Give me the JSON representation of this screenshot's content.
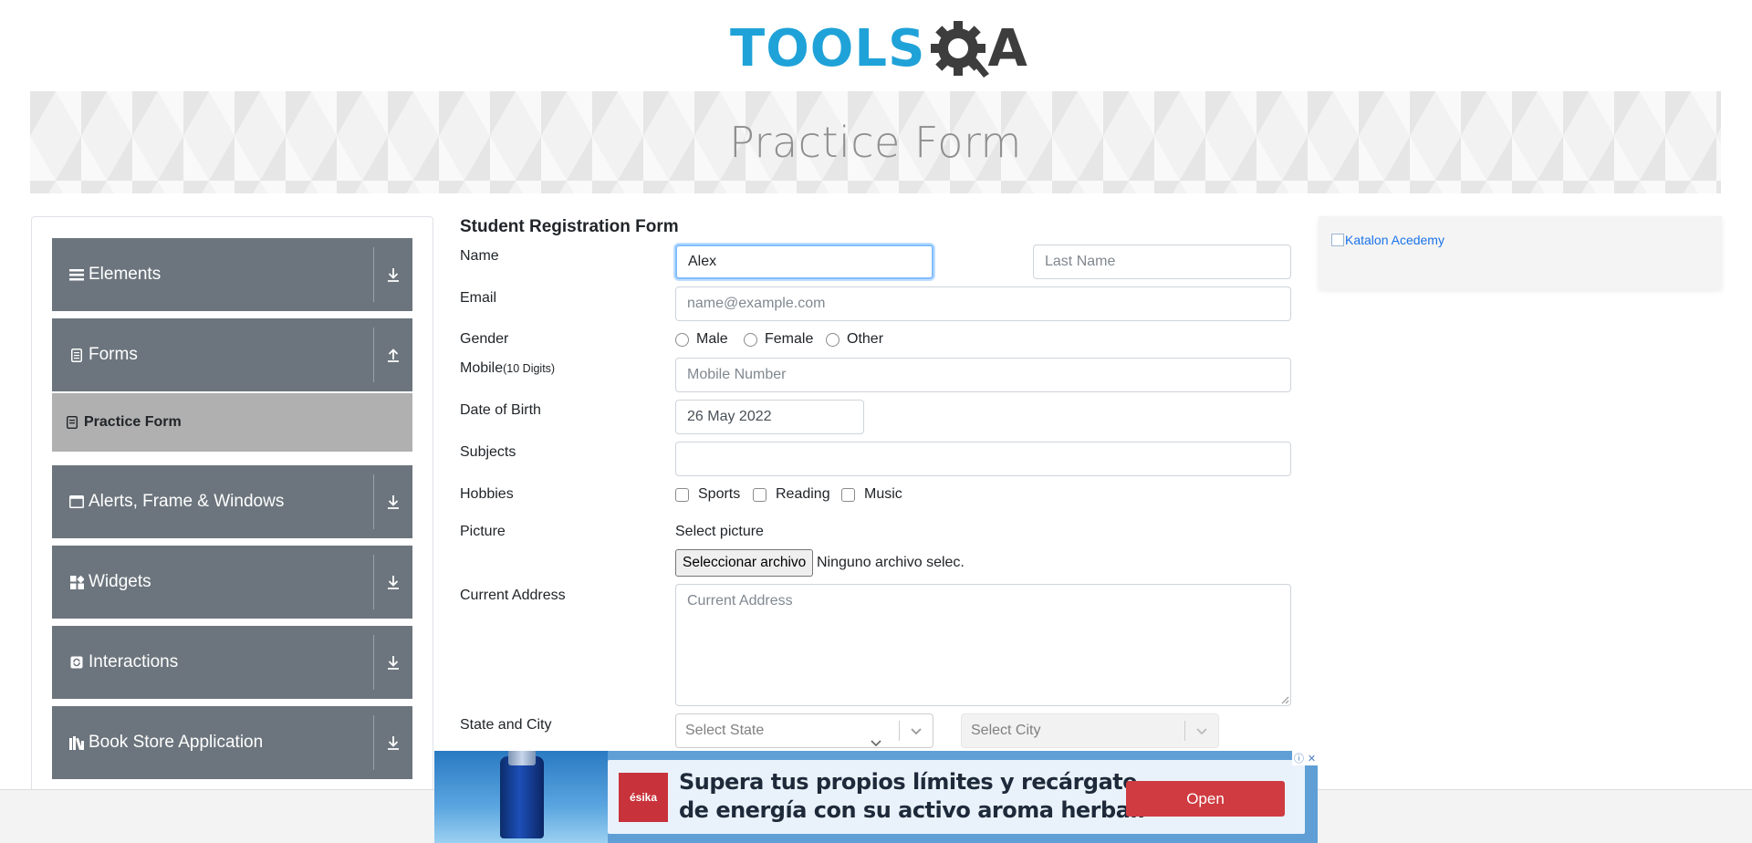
{
  "header": {
    "logo_text": "TOOLS",
    "logo_suffix": "A"
  },
  "banner": {
    "title": "Practice Form"
  },
  "sidebar": {
    "groups": [
      {
        "label": "Elements",
        "icon": "hamburger-icon",
        "state": "collapsed"
      },
      {
        "label": "Forms",
        "icon": "document-icon",
        "state": "expanded"
      },
      {
        "label": "Alerts, Frame & Windows",
        "icon": "window-icon",
        "state": "collapsed"
      },
      {
        "label": "Widgets",
        "icon": "grid-icon",
        "state": "collapsed"
      },
      {
        "label": "Interactions",
        "icon": "refresh-icon",
        "state": "collapsed"
      },
      {
        "label": "Book Store Application",
        "icon": "books-icon",
        "state": "collapsed"
      }
    ],
    "active_item": {
      "label": "Practice Form",
      "icon": "form-icon"
    }
  },
  "form": {
    "title": "Student Registration Form",
    "name_label": "Name",
    "first_name_value": "Alex",
    "last_name_placeholder": "Last Name",
    "email_label": "Email",
    "email_placeholder": "name@example.com",
    "gender_label": "Gender",
    "genders": [
      "Male",
      "Female",
      "Other"
    ],
    "mobile_label": "Mobile",
    "mobile_hint": "(10 Digits)",
    "mobile_placeholder": "Mobile Number",
    "dob_label": "Date of Birth",
    "dob_value": "26 May 2022",
    "subjects_label": "Subjects",
    "subjects_value": "",
    "hobbies_label": "Hobbies",
    "hobbies": [
      "Sports",
      "Reading",
      "Music"
    ],
    "picture_label": "Picture",
    "picture_prompt": "Select picture",
    "file_button": "Seleccionar archivo",
    "file_status": "Ninguno archivo selec.",
    "address_label": "Current Address",
    "address_placeholder": "Current Address",
    "state_city_label": "State and City",
    "state_placeholder": "Select State",
    "city_placeholder": "Select City"
  },
  "right_ad": {
    "alt_text": "Katalon Acedemy"
  },
  "bottom_ad": {
    "brand": "ésika",
    "line1": "Supera tus propios límites y recárgate",
    "line2": "de energía con su activo aroma herbal.",
    "cta": "Open"
  },
  "colors": {
    "logo_blue": "#1fa2d8",
    "logo_dark": "#3d3d3d",
    "sidebar_group": "#6c757d",
    "sidebar_active": "#b0b0b0",
    "focus_border": "#80bdff",
    "ad_button": "#cf3b40"
  }
}
